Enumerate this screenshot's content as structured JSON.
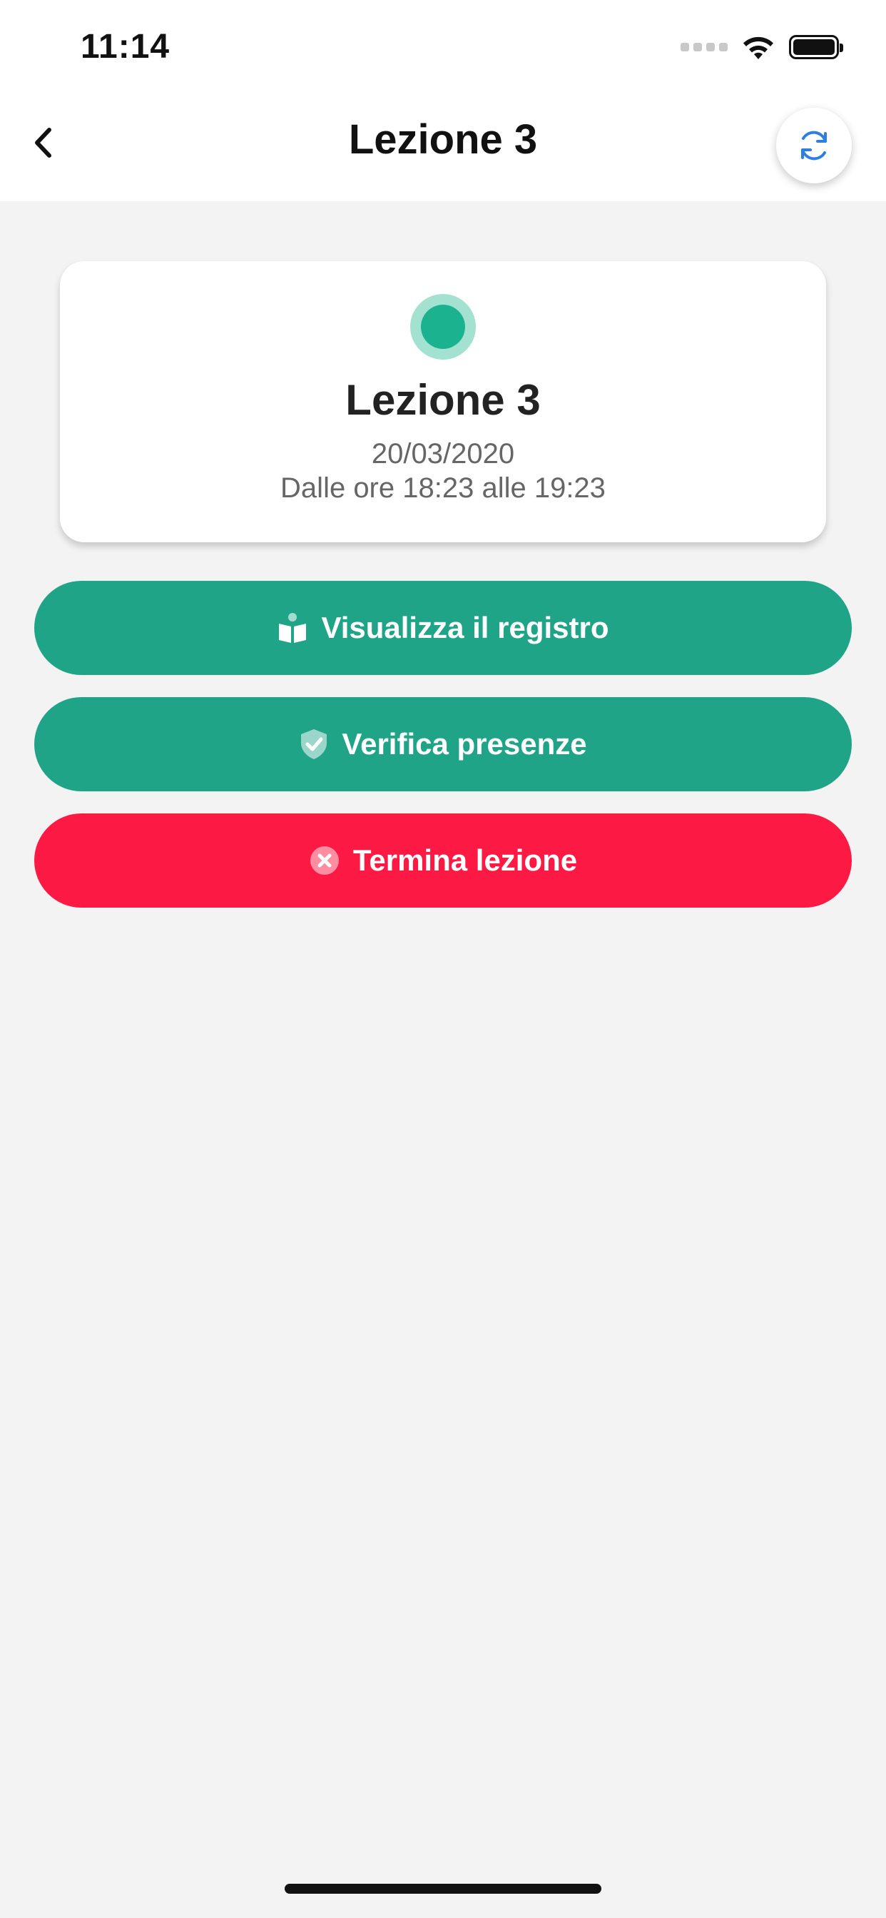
{
  "status_bar": {
    "time": "11:14",
    "icons": [
      "signal-dots-icon",
      "wifi-icon",
      "battery-icon"
    ]
  },
  "nav": {
    "title": "Lezione 3",
    "back_icon": "chevron-left-icon",
    "refresh_icon": "refresh-icon"
  },
  "lesson_card": {
    "status_color": "#1ab28f",
    "title": "Lezione 3",
    "date": "20/03/2020",
    "hours": "Dalle ore 18:23 alle 19:23"
  },
  "actions": {
    "register": {
      "label": "Visualizza il registro",
      "icon": "book-reader-icon",
      "color": "#20a488"
    },
    "attendance": {
      "label": "Verifica presenze",
      "icon": "shield-check-icon",
      "color": "#20a488"
    },
    "end": {
      "label": "Termina lezione",
      "icon": "close-circle-icon",
      "color": "#fc1a44"
    }
  },
  "colors": {
    "accent_green": "#20a488",
    "danger_red": "#fc1a44",
    "refresh_blue": "#2f7fe0",
    "background": "#f3f3f3"
  }
}
